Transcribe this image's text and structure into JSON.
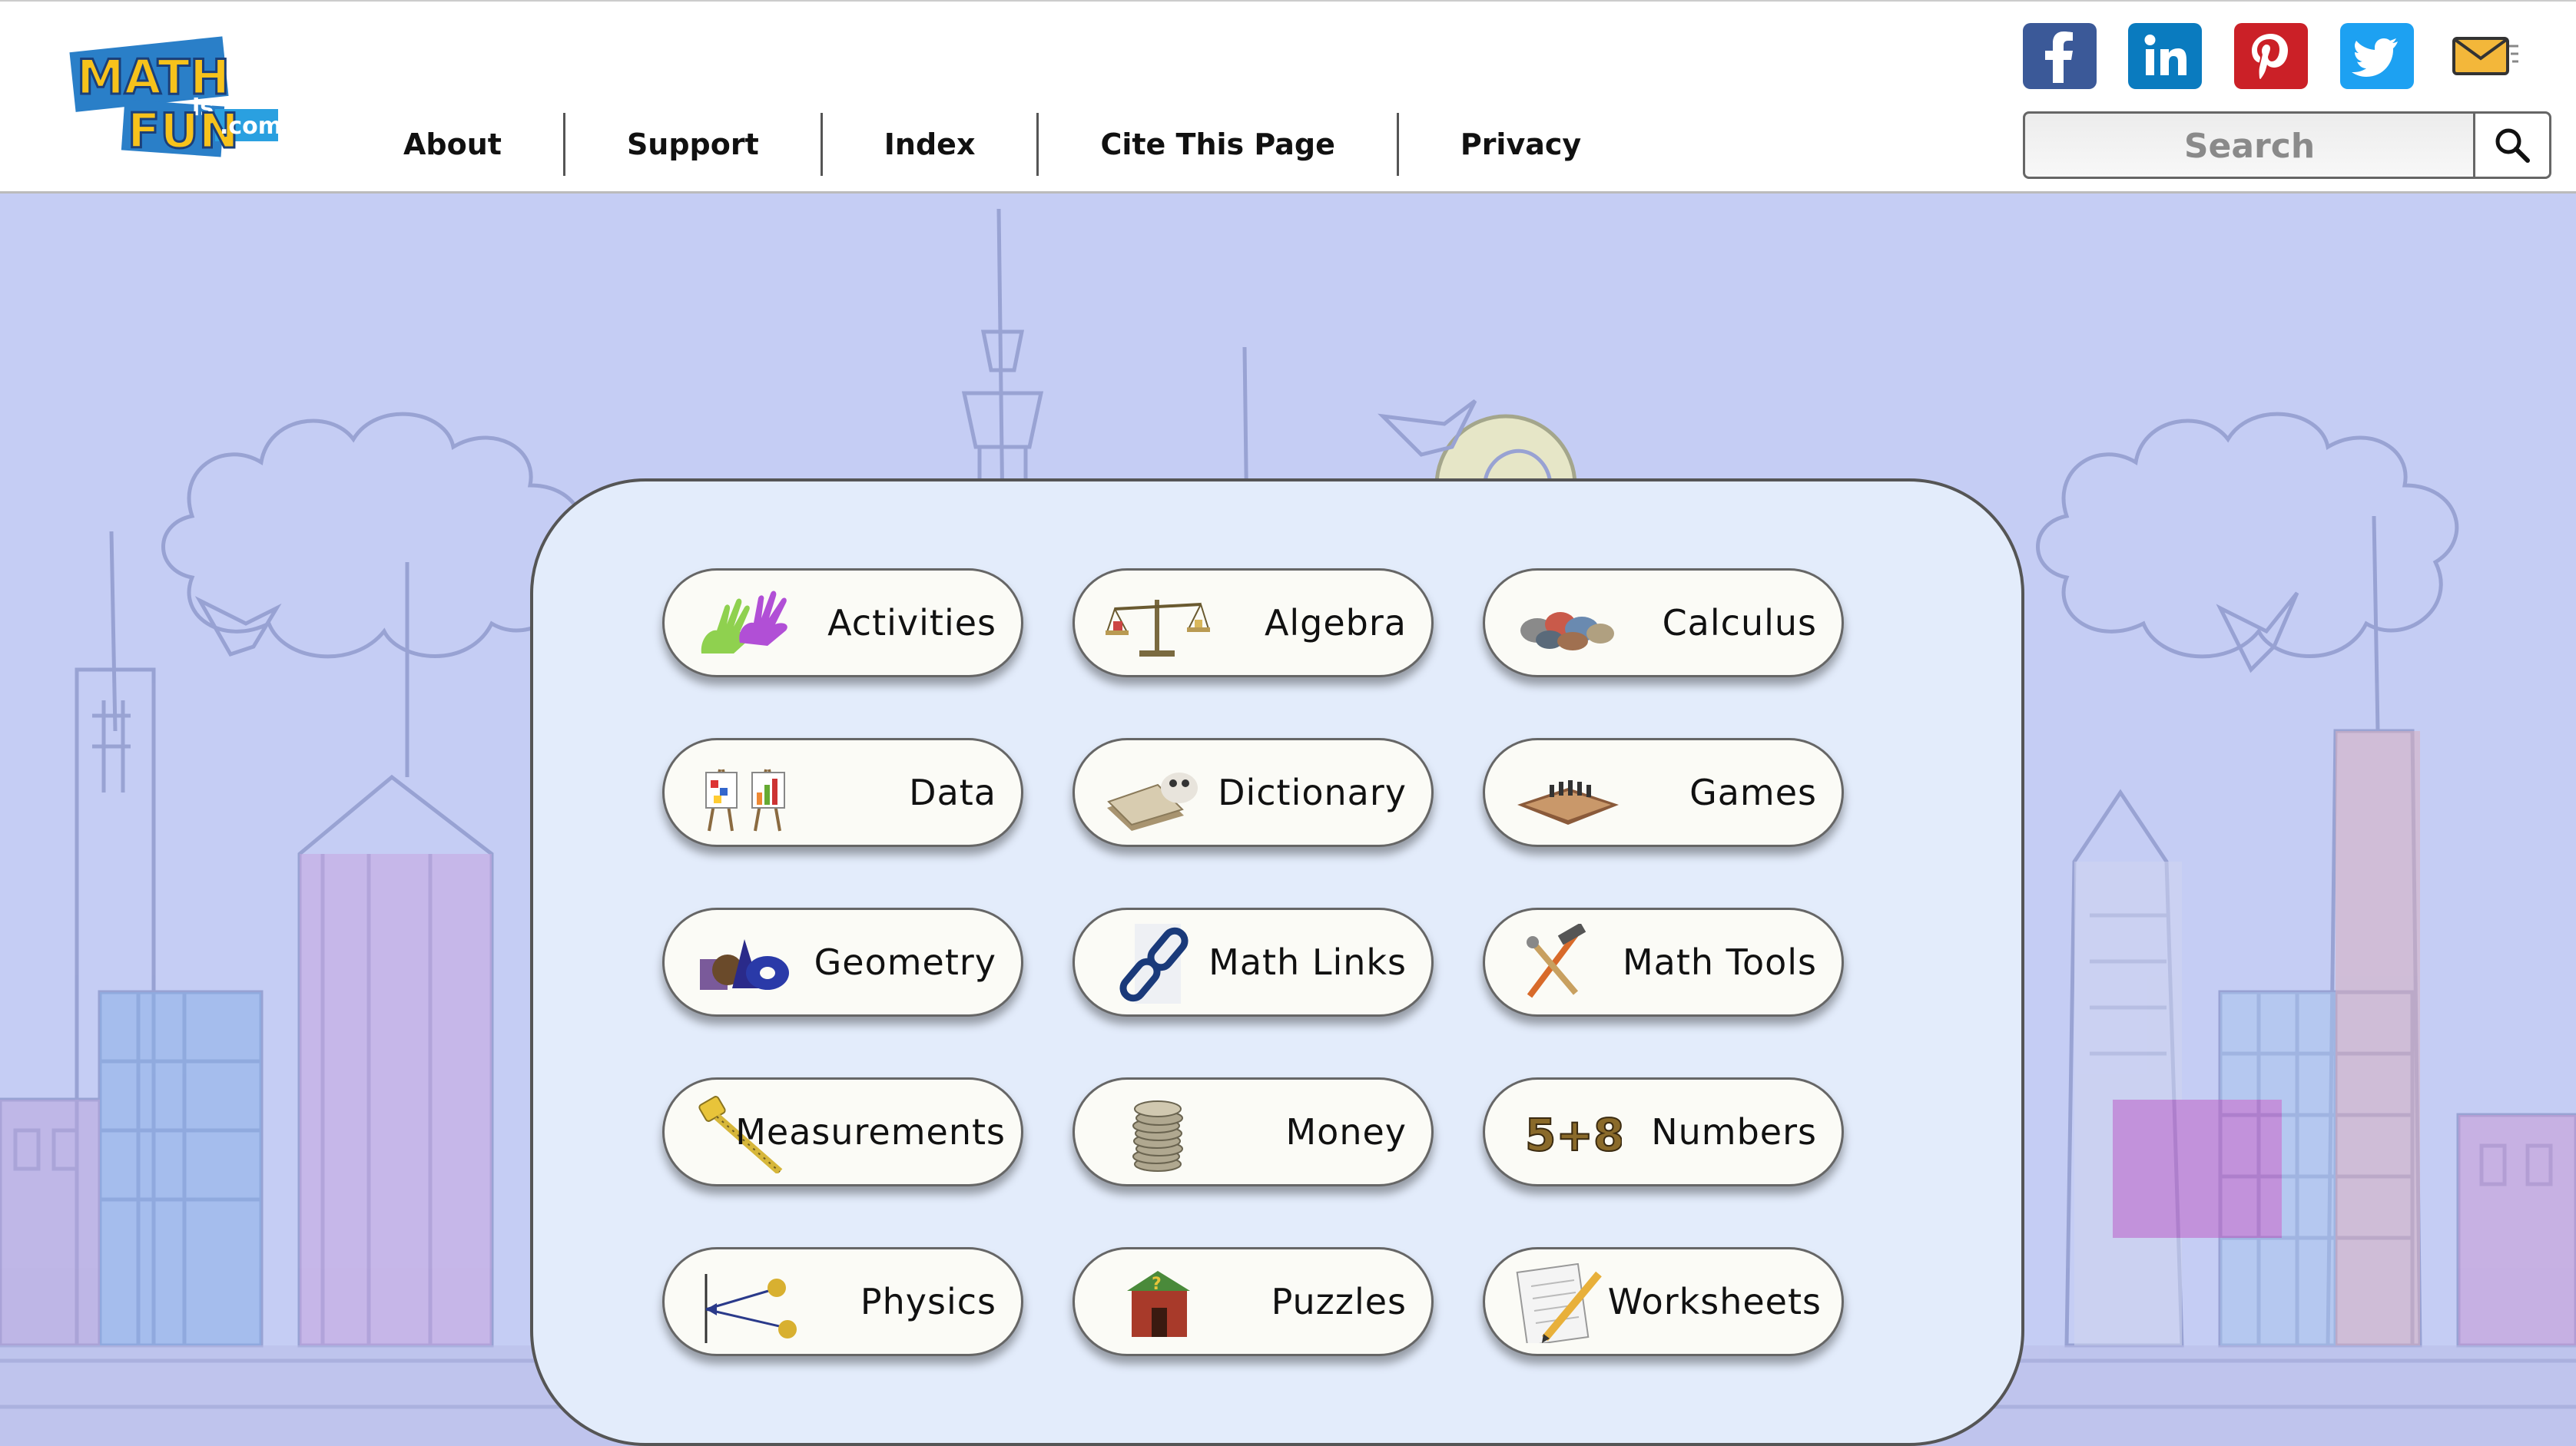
{
  "logo": {
    "text_main": "MATH",
    "text_is": "is",
    "text_fun": "FUN",
    "text_com": ".com"
  },
  "nav": {
    "items": [
      {
        "label": "About"
      },
      {
        "label": "Support"
      },
      {
        "label": "Index"
      },
      {
        "label": "Cite This Page"
      },
      {
        "label": "Privacy"
      }
    ]
  },
  "social": [
    {
      "name": "facebook-icon",
      "color": "#3b5998"
    },
    {
      "name": "linkedin-icon",
      "color": "#0a7bbf"
    },
    {
      "name": "pinterest-icon",
      "color": "#cb2027"
    },
    {
      "name": "twitter-icon",
      "color": "#1da1f2"
    },
    {
      "name": "email-icon",
      "color": "#e6a01e"
    }
  ],
  "search": {
    "placeholder": "Search"
  },
  "topics": [
    {
      "label": "Activities"
    },
    {
      "label": "Algebra"
    },
    {
      "label": "Calculus"
    },
    {
      "label": "Data"
    },
    {
      "label": "Dictionary"
    },
    {
      "label": "Games"
    },
    {
      "label": "Geometry"
    },
    {
      "label": "Math Links"
    },
    {
      "label": "Math Tools"
    },
    {
      "label": "Measurements"
    },
    {
      "label": "Money"
    },
    {
      "label": "Numbers"
    },
    {
      "label": "Physics"
    },
    {
      "label": "Puzzles"
    },
    {
      "label": "Worksheets"
    }
  ],
  "numbers_icon_text": "5+8",
  "colors": {
    "scene_bg": "#c5cdf4",
    "panel_bg": "#e3ecfb",
    "tile_bg": "#fbfbf6"
  }
}
